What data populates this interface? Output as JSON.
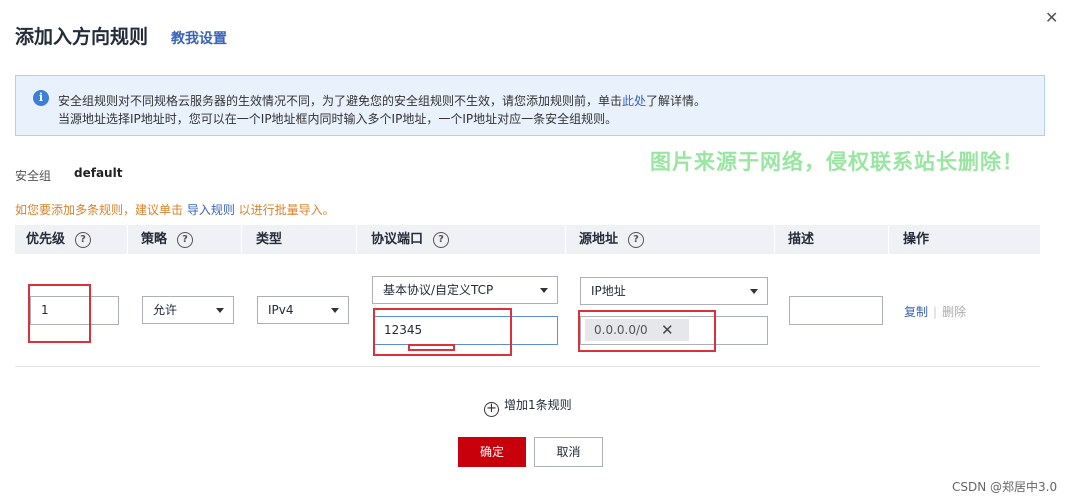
{
  "dialog": {
    "title": "添加入方向规则",
    "title_link": "教我设置",
    "close_icon": "close-icon"
  },
  "info": {
    "icon": "info-icon",
    "line1_before": "安全组规则对不同规格云服务器的生效情况不同，为了避免您的安全组规则不生效，请您添加规则前，单击",
    "line1_link": "此处",
    "line1_after": "了解详情。",
    "line2": "当源地址选择IP地址时，您可以在一个IP地址框内同时输入多个IP地址，一个IP地址对应一条安全组规则。"
  },
  "watermark": "图片来源于网络，侵权联系站长删除！",
  "security_group": {
    "label": "安全组",
    "value": "default"
  },
  "tip": {
    "before": "如您要添加多条规则，建议单击 ",
    "link": "导入规则",
    "after": " 以进行批量导入。"
  },
  "table": {
    "headers": {
      "priority": "优先级",
      "policy": "策略",
      "type": "类型",
      "protocol_port": "协议端口",
      "source": "源地址",
      "description": "描述",
      "action": "操作"
    },
    "help_icon": "?",
    "row": {
      "priority": "1",
      "policy": "允许",
      "type": "IPv4",
      "protocol": "基本协议/自定义TCP",
      "port": "12345",
      "source_type": "IP地址",
      "source_value": "0.0.0.0/0",
      "description": "",
      "copy": "复制",
      "delete": "删除"
    }
  },
  "add_rule": "增加1条规则",
  "buttons": {
    "confirm": "确定",
    "cancel": "取消"
  },
  "footer": "CSDN @郑居中3.0",
  "colors": {
    "primary": "#c7000b",
    "link": "#3a63b8",
    "highlight": "#d9323a",
    "tip": "#d9822b"
  }
}
